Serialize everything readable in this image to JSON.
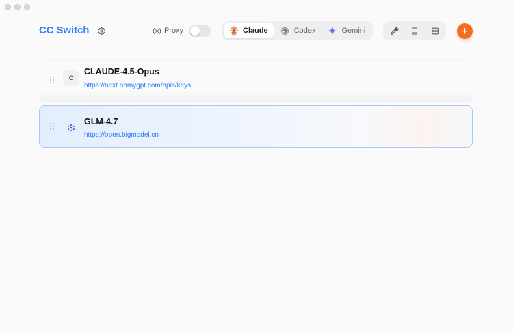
{
  "app": {
    "title": "CC Switch"
  },
  "proxy": {
    "label": "Proxy",
    "enabled": false
  },
  "tabs": [
    {
      "label": "Claude",
      "icon": "claude-icon",
      "active": true
    },
    {
      "label": "Codex",
      "icon": "codex-icon",
      "active": false
    },
    {
      "label": "Gemini",
      "icon": "gemini-icon",
      "active": false
    }
  ],
  "tools": [
    {
      "icon": "wrench-icon"
    },
    {
      "icon": "book-icon"
    },
    {
      "icon": "server-icon"
    }
  ],
  "add_button": {
    "icon": "plus-icon"
  },
  "providers": [
    {
      "name": "CLAUDE-4.5-Opus",
      "url": "https://next.ohmygpt.com/apis/keys",
      "logo_text": "C",
      "active": false
    },
    {
      "name": "GLM-4.7",
      "url": "https://open.bigmodel.cn",
      "logo_text": "",
      "logo_icon": "zhipu-logo-icon",
      "active": true
    }
  ],
  "colors": {
    "brand": "#2d7ff9",
    "accent": "#f36c21",
    "active_border": "#a9c9f2"
  }
}
